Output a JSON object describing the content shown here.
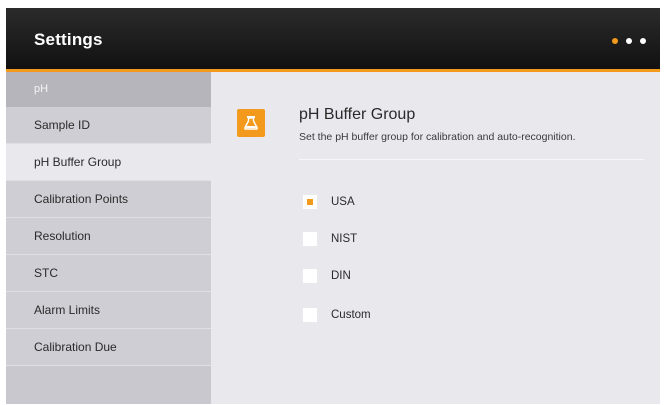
{
  "header": {
    "title": "Settings",
    "page_dots": {
      "count": 3,
      "active_index": 0
    }
  },
  "sidebar": {
    "section_label": "pH",
    "items": [
      {
        "label": "Sample ID",
        "selected": false
      },
      {
        "label": "pH Buffer Group",
        "selected": true
      },
      {
        "label": "Calibration Points",
        "selected": false
      },
      {
        "label": "Resolution",
        "selected": false
      },
      {
        "label": "STC",
        "selected": false
      },
      {
        "label": "Alarm Limits",
        "selected": false
      },
      {
        "label": "Calibration Due",
        "selected": false
      }
    ]
  },
  "content": {
    "icon": "beaker-icon",
    "title": "pH Buffer Group",
    "description": "Set the pH buffer group for calibration and auto-recognition.",
    "options": [
      {
        "label": "USA",
        "selected": true
      },
      {
        "label": "NIST",
        "selected": false
      },
      {
        "label": "DIN",
        "selected": false
      },
      {
        "label": "Custom",
        "selected": false
      }
    ]
  },
  "colors": {
    "accent": "#f39a1c",
    "header_bg": "#1a1a1a",
    "background": "#e9e8ed",
    "sidebar_bg": "#cfced5",
    "sidebar_section_bg": "#b6b5bc"
  }
}
